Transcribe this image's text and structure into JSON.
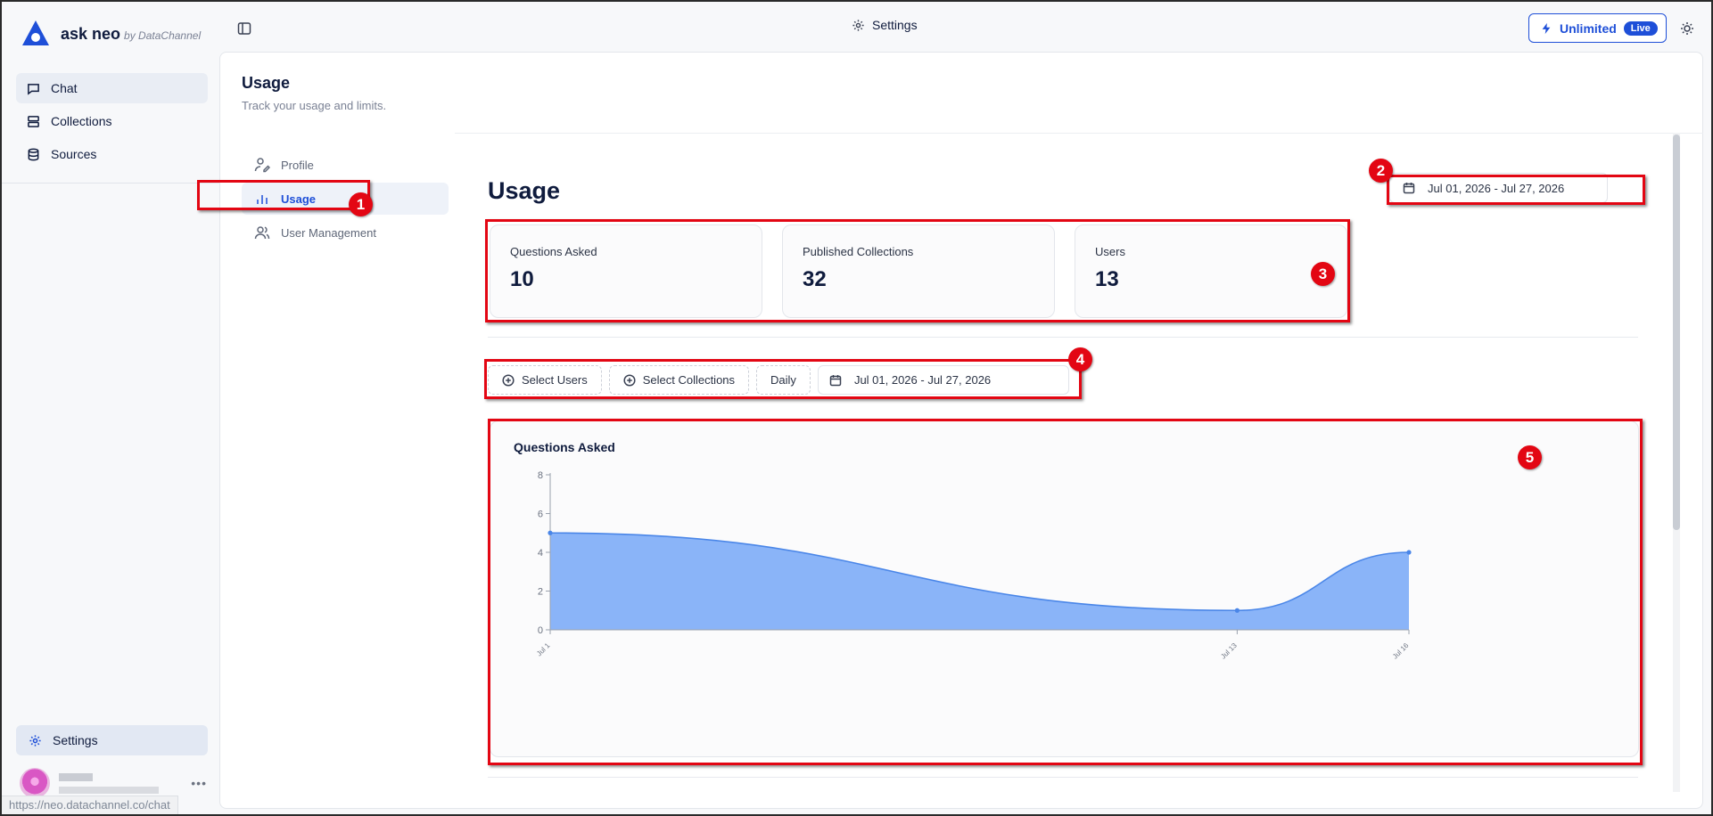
{
  "brand": {
    "name": "ask neo",
    "by": "by DataChannel"
  },
  "sidebar": {
    "items": [
      {
        "label": "Chat",
        "icon": "chat-icon",
        "active": true
      },
      {
        "label": "Collections",
        "icon": "collections-icon",
        "active": false
      },
      {
        "label": "Sources",
        "icon": "database-icon",
        "active": false
      }
    ],
    "settings_label": "Settings",
    "status_url": "https://neo.datachannel.co/chat"
  },
  "topbar": {
    "title": "Settings",
    "plan_label": "Unlimited",
    "live_badge": "Live",
    "accent": "#1e4fd8"
  },
  "page": {
    "title": "Usage",
    "subtitle": "Track your usage and limits."
  },
  "settings_nav": [
    {
      "label": "Profile",
      "icon": "user-edit-icon",
      "active": false
    },
    {
      "label": "Usage",
      "icon": "bar-chart-icon",
      "active": true
    },
    {
      "label": "User Management",
      "icon": "users-icon",
      "active": false
    }
  ],
  "usage": {
    "heading": "Usage",
    "date_range": "Jul 01, 2026 - Jul 27, 2026",
    "stats": [
      {
        "label": "Questions Asked",
        "value": "10"
      },
      {
        "label": "Published Collections",
        "value": "32"
      },
      {
        "label": "Users",
        "value": "13"
      }
    ],
    "filters": {
      "select_users": "Select Users",
      "select_collections": "Select Collections",
      "granularity": "Daily",
      "date_range": "Jul 01, 2026 - Jul 27, 2026"
    }
  },
  "annotations": [
    "1",
    "2",
    "3",
    "4",
    "5"
  ],
  "annotation_color": "#e30613",
  "chart_data": {
    "type": "area",
    "title": "Questions Asked",
    "categories": [
      "Jul 1",
      "Jul 13",
      "Jul 16"
    ],
    "values": [
      5,
      1,
      4
    ],
    "ylim": [
      0,
      8
    ],
    "yticks": [
      0,
      2,
      4,
      6,
      8
    ],
    "grid": false,
    "fill_color": "#8ab4f8",
    "line_color": "#4a86e8"
  }
}
